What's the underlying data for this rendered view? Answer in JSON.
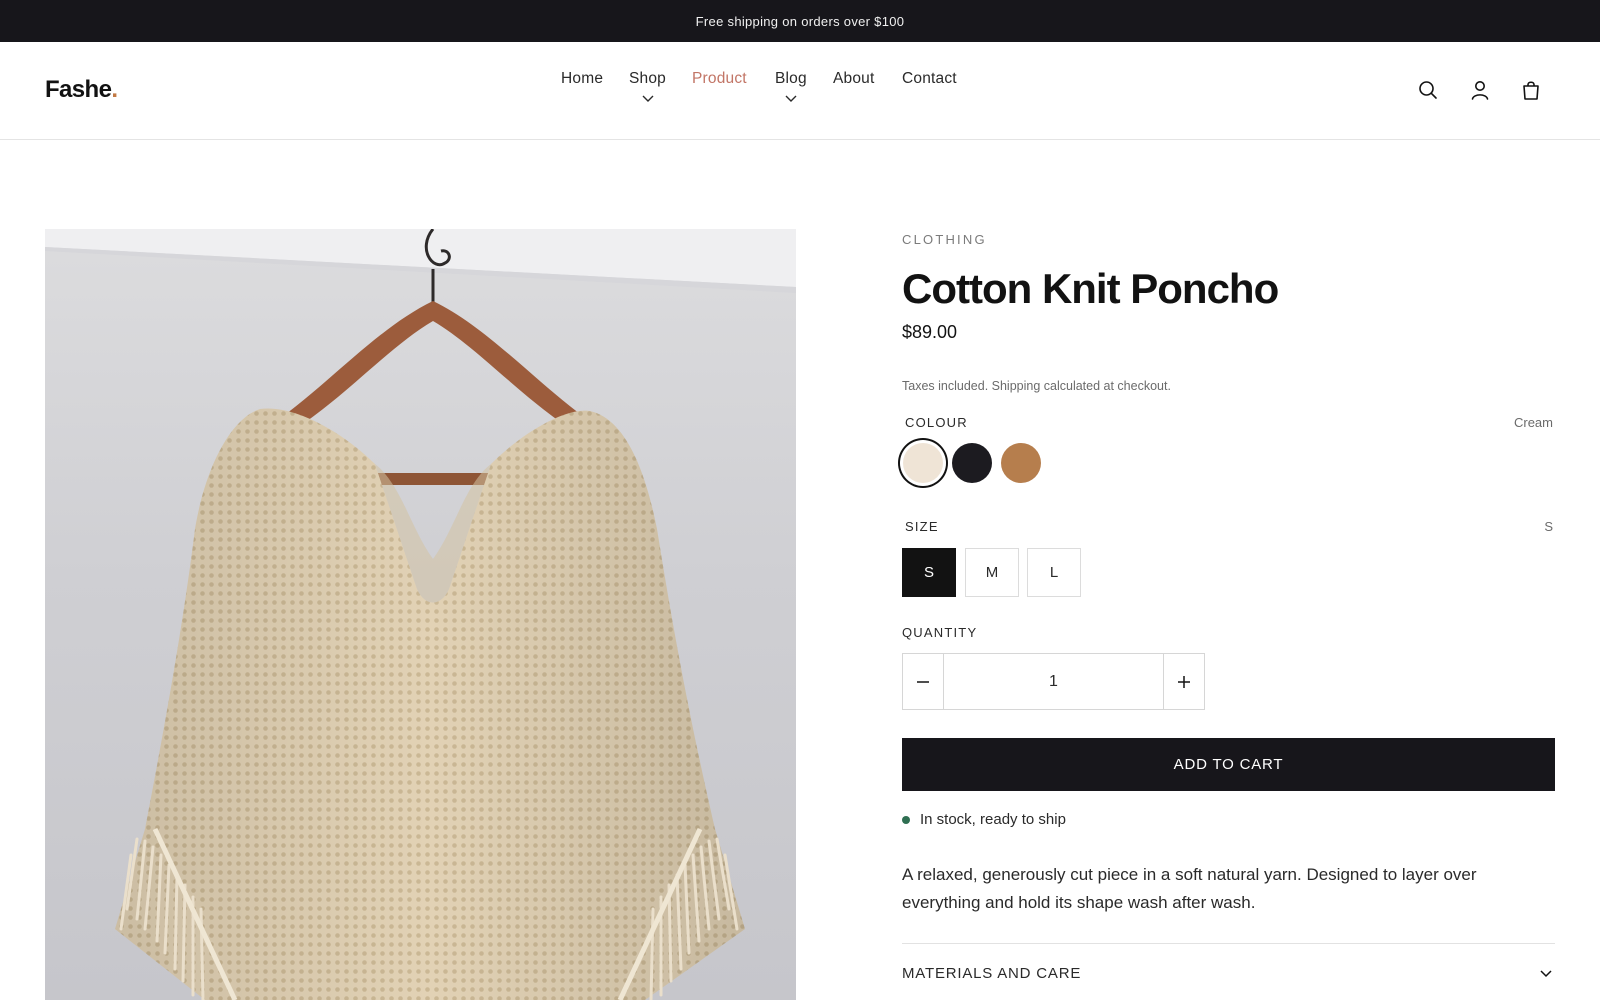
{
  "announcement": "Free shipping on orders over $100",
  "header": {
    "logo_text": "Fashe",
    "logo_dot": ".",
    "nav": [
      {
        "label": "Home"
      },
      {
        "label": "Shop"
      },
      {
        "label": "Product"
      },
      {
        "label": "Blog"
      },
      {
        "label": "About"
      },
      {
        "label": "Contact"
      }
    ],
    "active_nav": "Product",
    "icons": [
      "search-icon",
      "account-icon",
      "cart-bag-icon"
    ]
  },
  "product": {
    "category": "CLOTHING",
    "title": "Cotton Knit Poncho",
    "price": "$89.00",
    "tax_note": "Taxes included. Shipping calculated at checkout.",
    "colour": {
      "label": "COLOUR",
      "selected": "Cream",
      "swatches": [
        {
          "name": "Cream",
          "hex": "#efe4d6"
        },
        {
          "name": "Black",
          "hex": "#1c1b20"
        },
        {
          "name": "Tan",
          "hex": "#b67e4d"
        }
      ]
    },
    "size": {
      "label": "SIZE",
      "selected": "S",
      "options": [
        "S",
        "M",
        "L"
      ]
    },
    "quantity": {
      "label": "QUANTITY",
      "value": "1"
    },
    "add_to_cart": "ADD TO CART",
    "stock": "In stock, ready to ship",
    "description": "A relaxed, generously cut piece in a soft natural yarn. Designed to layer over everything and hold its shape wash after wash.",
    "accordion": "MATERIALS AND CARE"
  },
  "colors": {
    "accent": "#c27566",
    "logo_dot": "#c27a45",
    "dark": "#17161b",
    "stock_green": "#2f6f52"
  }
}
